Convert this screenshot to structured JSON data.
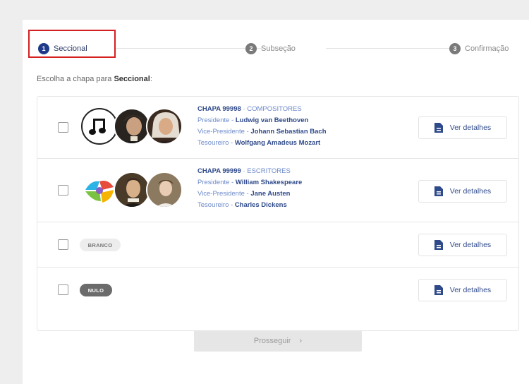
{
  "stepper": {
    "steps": [
      {
        "number": "1",
        "label": "Seccional"
      },
      {
        "number": "2",
        "label": "Subseção"
      },
      {
        "number": "3",
        "label": "Confirmação"
      }
    ]
  },
  "instruction": {
    "prefix": "Escolha a chapa para ",
    "bold": "Seccional",
    "suffix": ":"
  },
  "slates": [
    {
      "code": "CHAPA 99998",
      "sep": " · ",
      "category": "COMPOSITORES",
      "roles": [
        {
          "role": "Presidente",
          "name": "Ludwig van Beethoven"
        },
        {
          "role": "Vice-Presidente",
          "name": "Johann Sebastian Bach"
        },
        {
          "role": "Tesoureiro",
          "name": "Wolfgang Amadeus Mozart"
        }
      ],
      "details_label": "Ver detalhes"
    },
    {
      "code": "CHAPA 99999",
      "sep": " · ",
      "category": "ESCRITORES",
      "roles": [
        {
          "role": "Presidente",
          "name": "William Shakespeare"
        },
        {
          "role": "Vice-Presidente",
          "name": "Jane Austen"
        },
        {
          "role": "Tesoureiro",
          "name": "Charles Dickens"
        }
      ],
      "details_label": "Ver detalhes"
    }
  ],
  "special_options": [
    {
      "badge": "BRANCO",
      "details_label": "Ver detalhes"
    },
    {
      "badge": "NULO",
      "details_label": "Ver detalhes"
    }
  ],
  "role_sep": " - ",
  "proceed": {
    "label": "Prosseguir",
    "icon": "chevron-right-icon"
  },
  "colors": {
    "active": "#1e3a8a",
    "highlight": "#d42020",
    "link": "#2f4a8a"
  }
}
